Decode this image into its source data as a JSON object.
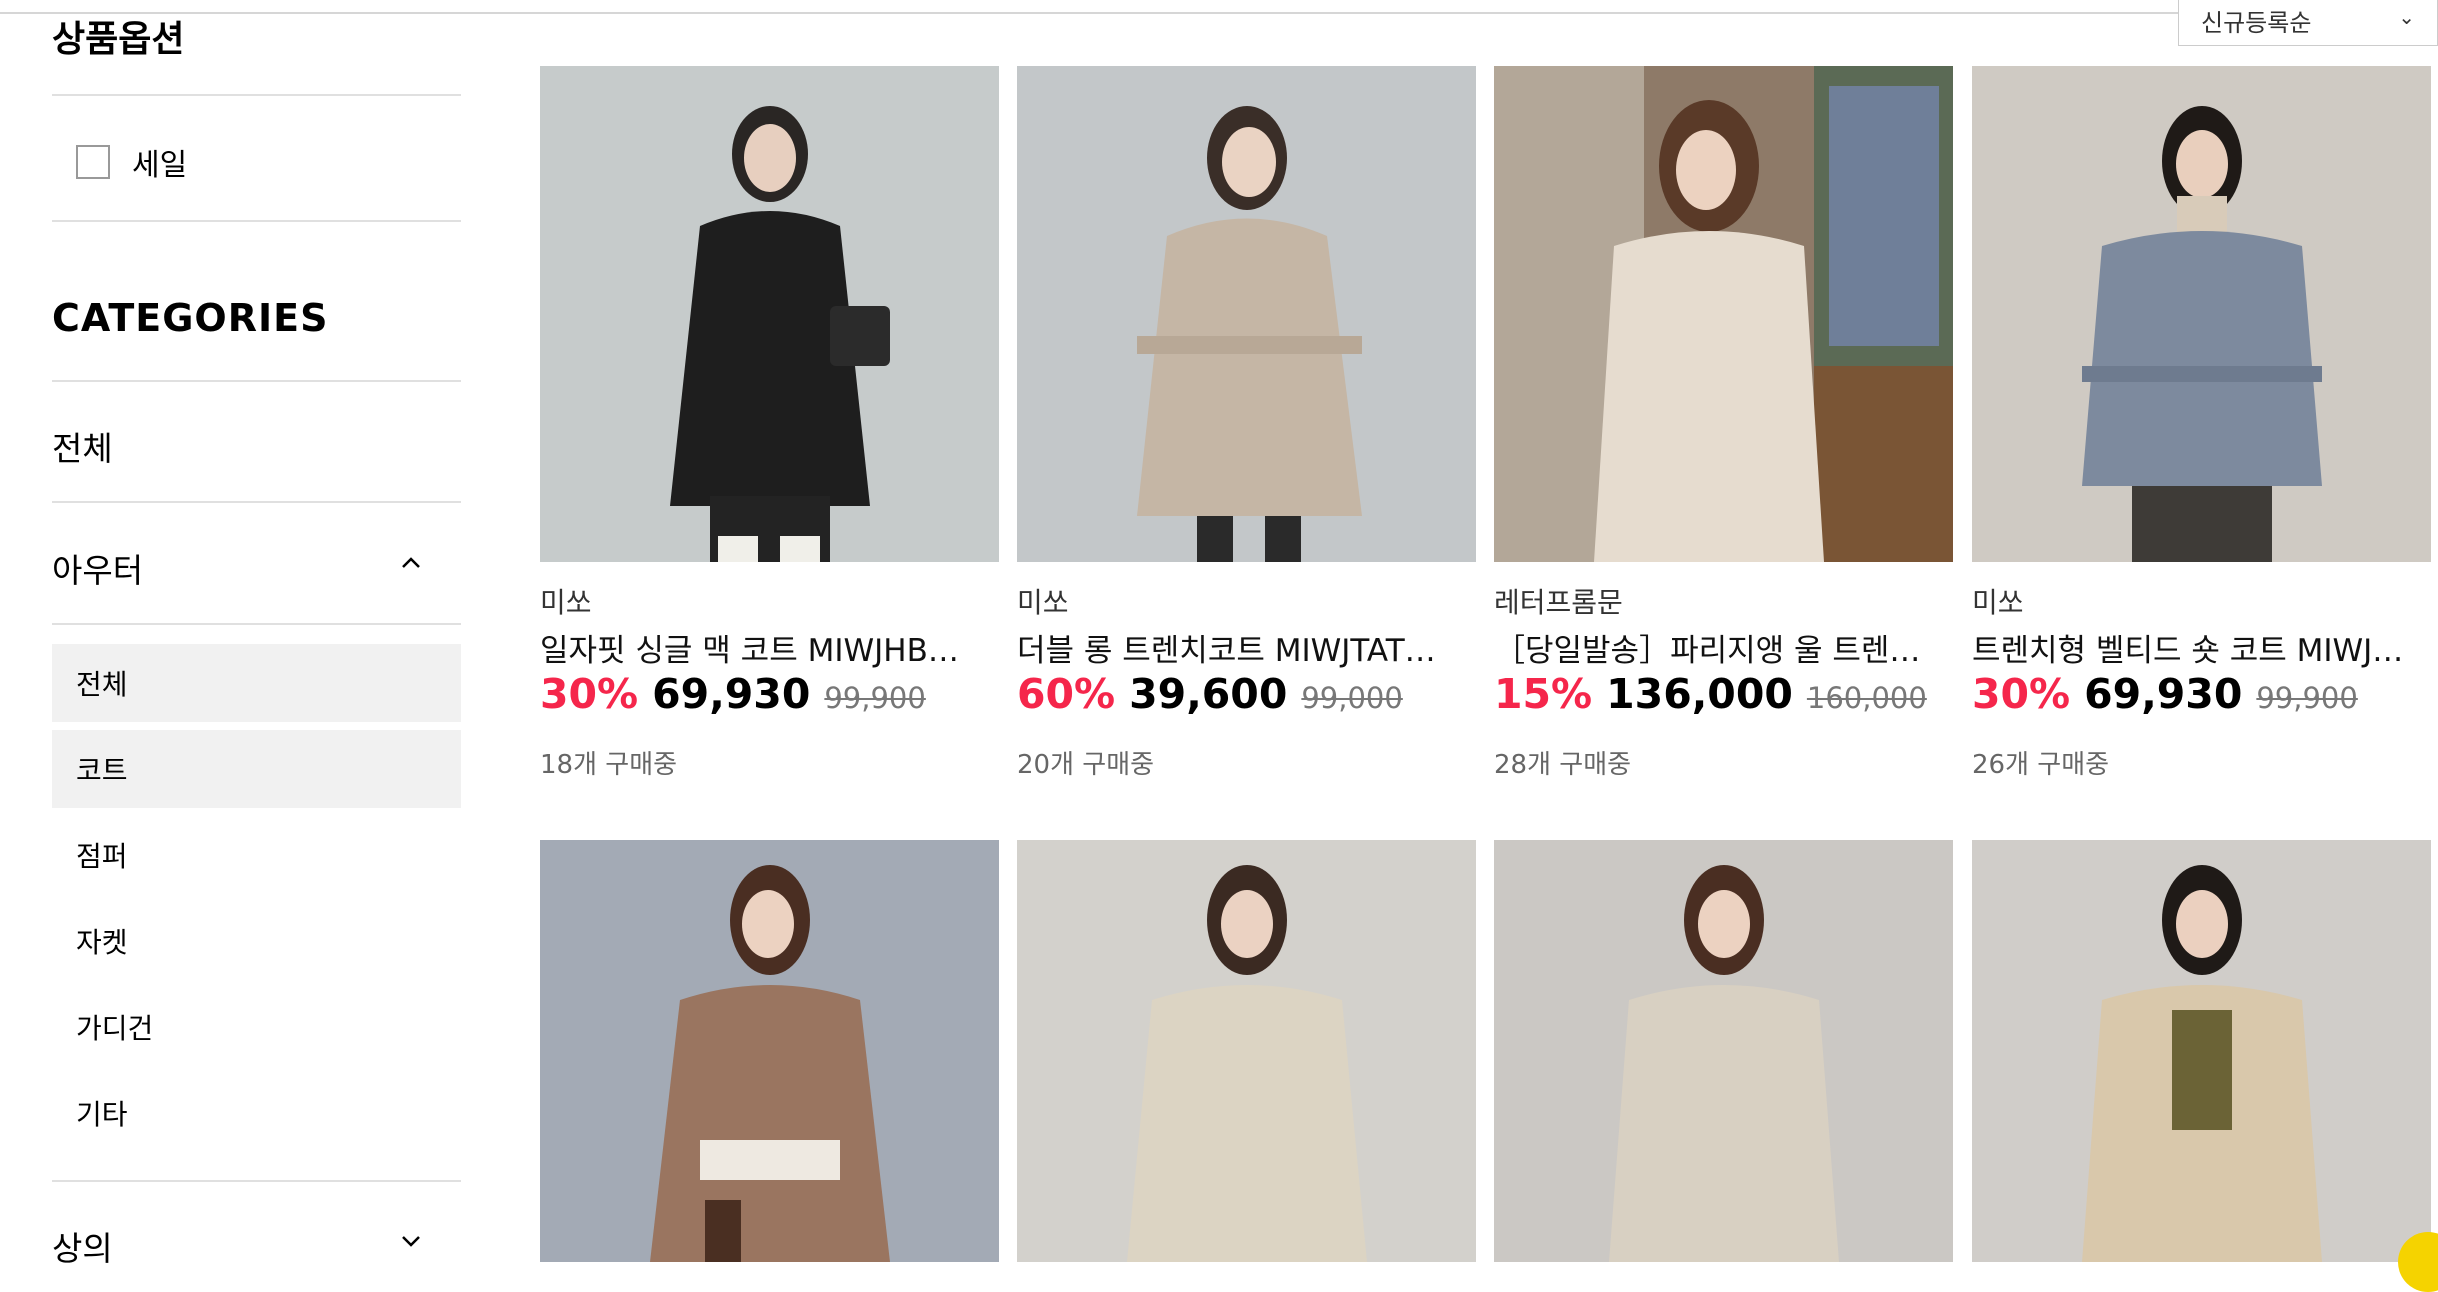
{
  "sort": {
    "label": "신규등록순",
    "icon": "chevron-down-icon"
  },
  "sidebar": {
    "option_title": "상품옵션",
    "sale_label": "세일",
    "categories_title": "CATEGORIES",
    "all_label": "전체",
    "outer_label": "아우터",
    "outer_sub": [
      "전체",
      "코트",
      "점퍼",
      "자켓",
      "가디건",
      "기타"
    ],
    "outer_sub_active": [
      "전체",
      "코트"
    ],
    "top_label": "상의"
  },
  "products": [
    {
      "brand": "미쏘",
      "name": "일자핏 싱글 맥 코트 MIWJHB…",
      "discount": "30%",
      "price": "69,930",
      "original": "99,900",
      "buyers": "18개 구매중"
    },
    {
      "brand": "미쏘",
      "name": "더블 롱 트렌치코트 MIWJTAT…",
      "discount": "60%",
      "price": "39,600",
      "original": "99,000",
      "buyers": "20개 구매중"
    },
    {
      "brand": "레터프롬문",
      "name": "［당일발송］파리지앵 울 트렌…",
      "discount": "15%",
      "price": "136,000",
      "original": "160,000",
      "buyers": "28개 구매중"
    },
    {
      "brand": "미쏘",
      "name": "트렌치형 벨티드 숏 코트 MIWJ…",
      "discount": "30%",
      "price": "69,930",
      "original": "99,900",
      "buyers": "26개 구매중"
    }
  ],
  "colors": {
    "discount": "#f5264b",
    "active_bg": "#f1f1f1",
    "divider": "#e0e0e0"
  }
}
